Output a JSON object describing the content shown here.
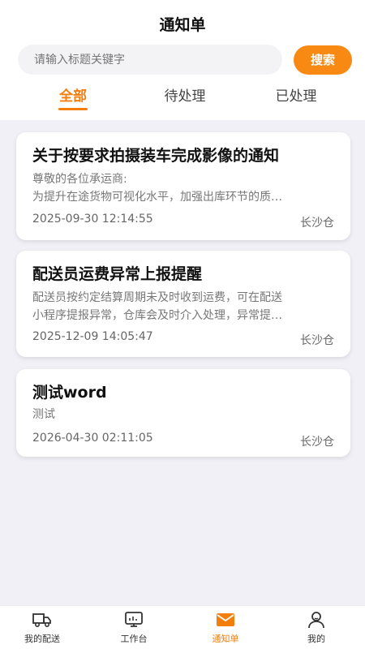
{
  "header": {
    "title": "通知单"
  },
  "search": {
    "placeholder": "请输入标题关键字",
    "button_label": "搜索"
  },
  "tabs": [
    {
      "label": "全部",
      "active": true
    },
    {
      "label": "待处理",
      "active": false
    },
    {
      "label": "已处理",
      "active": false
    }
  ],
  "notices": [
    {
      "title": "关于按要求拍摄装车完成影像的通知",
      "body_lines": [
        "尊敬的各位承运商:",
        "为提升在途货物可视化水平，加强出库环节的质…"
      ],
      "time": "2025-09-30 12:14:55",
      "location": "长沙仓"
    },
    {
      "title": "配送员运费异常上报提醒",
      "body_lines": [
        "配送员按约定结算周期未及时收到运费，可在配送",
        "小程序提报异常，仓库会及时介入处理，异常提…"
      ],
      "time": "2025-12-09 14:05:47",
      "location": "长沙仓"
    },
    {
      "title": "测试word",
      "body_lines": [
        "测试"
      ],
      "time": "2026-04-30 02:11:05",
      "location": "长沙仓"
    }
  ],
  "bottom_nav": [
    {
      "label": "我的配送",
      "icon": "truck-icon",
      "active": false
    },
    {
      "label": "工作台",
      "icon": "monitor-icon",
      "active": false
    },
    {
      "label": "通知单",
      "icon": "mail-icon",
      "active": true
    },
    {
      "label": "我的",
      "icon": "user-icon",
      "active": false
    }
  ],
  "colors": {
    "accent": "#f47e0d",
    "button": "#f88a14",
    "background": "#f1f0f6"
  }
}
